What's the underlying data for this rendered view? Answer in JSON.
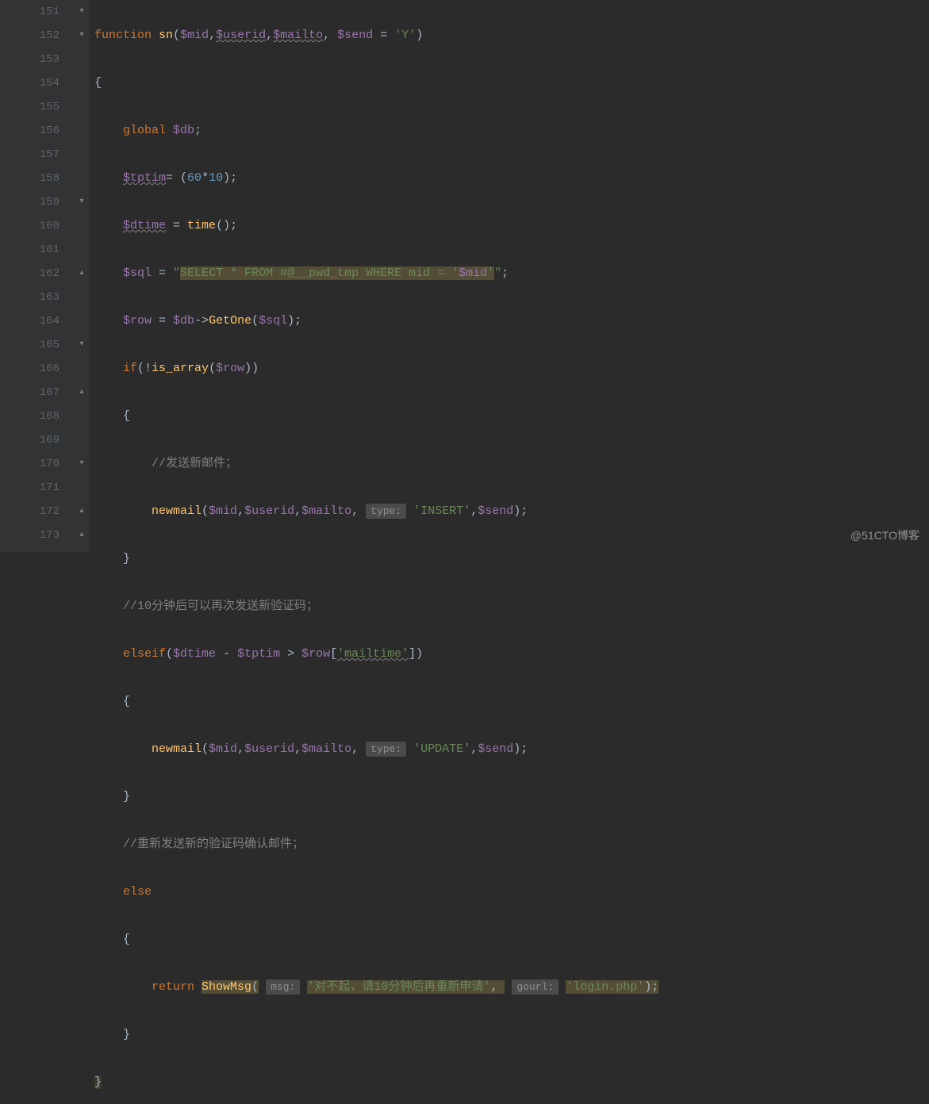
{
  "lines": {
    "start": 151,
    "end": 173
  },
  "code": {
    "l151": {
      "fn_kw": "function",
      "fn_name": "sn",
      "p1": "$mid",
      "p2": "$userid",
      "p3": "$mailto",
      "p4": "$send",
      "eq": "=",
      "def": "'Y'"
    },
    "l152": {
      "brace": "{"
    },
    "l153": {
      "kw": "global",
      "var": "$db",
      "semi": ";"
    },
    "l154": {
      "var": "$tptim",
      "eq": "= (",
      "n1": "60",
      "op": "*",
      "n2": "10",
      "end": ");"
    },
    "l155": {
      "var": "$dtime",
      "eq": " = ",
      "fn": "time",
      "end": "();"
    },
    "l156": {
      "var": "$sql",
      "eq": " = ",
      "q1": "\"",
      "sql": "SELECT * FROM #@__pwd_tmp WHERE mid = '",
      "ivar": "$mid",
      "q2": "'",
      "q3": "\"",
      "semi": ";"
    },
    "l157": {
      "var": "$row",
      "eq": " = ",
      "obj": "$db",
      "arrow": "->",
      "fn": "GetOne",
      "lp": "(",
      "arg": "$sql",
      "rp": ");"
    },
    "l158": {
      "kw": "if",
      "lp": "(!",
      "fn": "is_array",
      "lp2": "(",
      "arg": "$row",
      "rp": "))"
    },
    "l159": {
      "brace": "{"
    },
    "l160": {
      "cmt": "//发送新邮件；"
    },
    "l161": {
      "fn": "newmail",
      "lp": "(",
      "a1": "$mid",
      "a2": "$userid",
      "a3": "$mailto",
      "hint": "type:",
      "str": "'INSERT'",
      "a4": "$send",
      "rp": ");"
    },
    "l162": {
      "brace": "}"
    },
    "l163": {
      "cmt": "//10分钟后可以再次发送新验证码；"
    },
    "l164": {
      "kw": "elseif",
      "lp": "(",
      "v1": "$dtime",
      "op1": " - ",
      "v2": "$tptim",
      "op2": " > ",
      "v3": "$row",
      "lb": "[",
      "key": "'mailtime'",
      "rb": "])"
    },
    "l165": {
      "brace": "{"
    },
    "l166": {
      "fn": "newmail",
      "lp": "(",
      "a1": "$mid",
      "a2": "$userid",
      "a3": "$mailto",
      "hint": "type:",
      "str": "'UPDATE'",
      "a4": "$send",
      "rp": ");"
    },
    "l167": {
      "brace": "}"
    },
    "l168": {
      "cmt": "//重新发送新的验证码确认邮件；"
    },
    "l169": {
      "kw": "else"
    },
    "l170": {
      "brace": "{"
    },
    "l171": {
      "kw": "return",
      "fn": "ShowMsg",
      "lp": "(",
      "hint1": "msg:",
      "str1": "'对不起，请10分钟后再重新申请'",
      "comma": ", ",
      "hint2": "gourl:",
      "str2": "'login.php'",
      "rp": ");"
    },
    "l172": {
      "brace": "}"
    },
    "l173": {
      "brace": "}"
    }
  },
  "watermark": "@51CTO博客"
}
